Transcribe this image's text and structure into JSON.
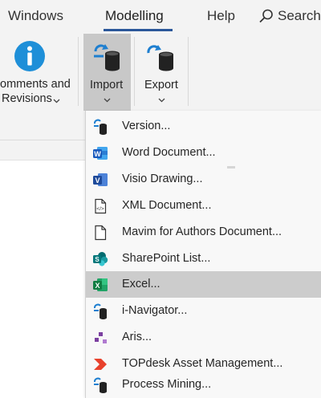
{
  "tabs": {
    "windows": "Windows",
    "modelling": "Modelling",
    "help": "Help",
    "search": "Search"
  },
  "ribbon": {
    "comments_line1": "omments and",
    "comments_line2": "Revisions",
    "import_label": "Import",
    "export_label": "Export"
  },
  "menu": {
    "items": [
      {
        "label": "Version...",
        "icon": "version-db-icon"
      },
      {
        "label": "Word Document...",
        "icon": "word-icon"
      },
      {
        "label": "Visio Drawing...",
        "icon": "visio-icon"
      },
      {
        "label": "XML Document...",
        "icon": "xml-document-icon"
      },
      {
        "label": "Mavim for Authors Document...",
        "icon": "document-icon"
      },
      {
        "label": "SharePoint List...",
        "icon": "sharepoint-icon"
      },
      {
        "label": "Excel...",
        "icon": "excel-icon",
        "highlighted": true
      },
      {
        "label": "i-Navigator...",
        "icon": "inavigator-db-icon"
      },
      {
        "label": "Aris...",
        "icon": "aris-icon"
      },
      {
        "label": "TOPdesk Asset Management...",
        "icon": "topdesk-icon"
      },
      {
        "label": "Process Mining...",
        "icon": "process-mining-db-icon"
      }
    ]
  },
  "colors": {
    "accent": "#2b579a",
    "info_blue": "#1e8fd8",
    "highlight": "#cccccc"
  }
}
